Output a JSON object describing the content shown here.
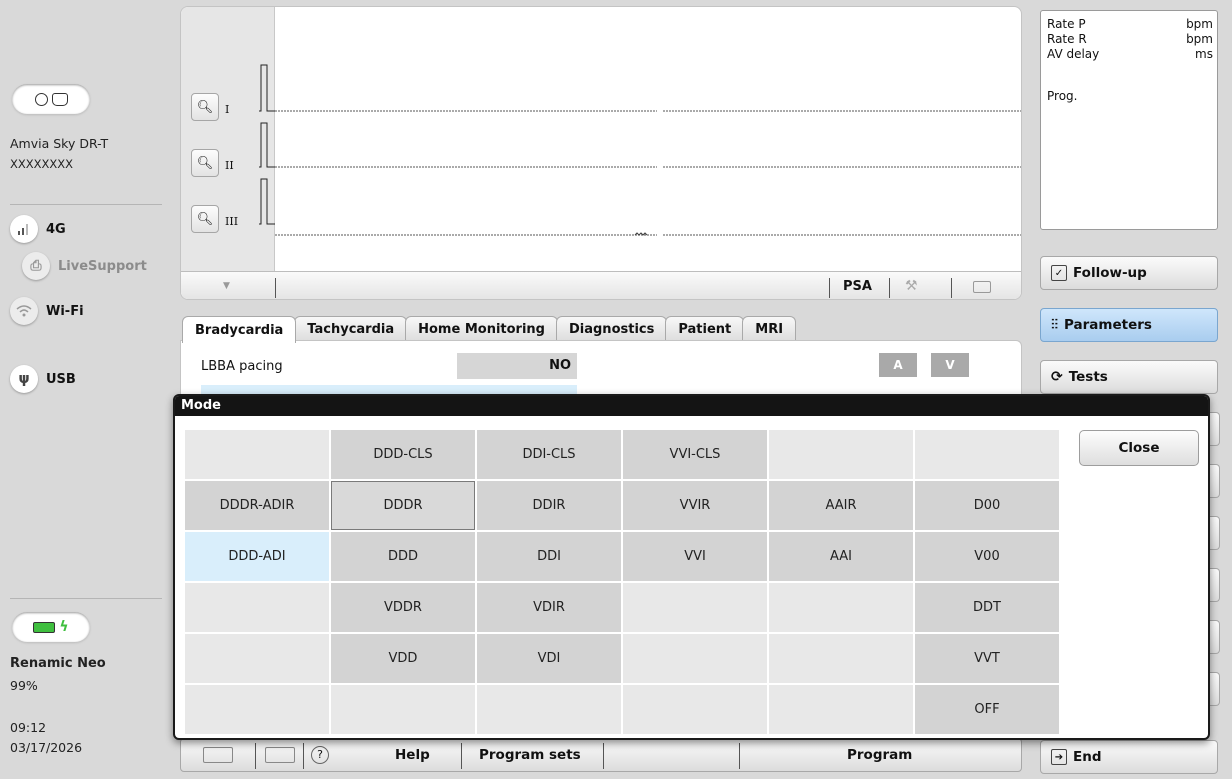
{
  "sidebar": {
    "device_name": "Amvia Sky DR-T",
    "serial": "XXXXXXXX",
    "connections": [
      {
        "label": "4G",
        "icon": "signal-bars-icon",
        "dim": false
      },
      {
        "label": "LiveSupport",
        "icon": "livesupport-icon",
        "dim": true
      },
      {
        "label": "Wi-Fi",
        "icon": "wifi-icon",
        "dim": false
      },
      {
        "label": "USB",
        "icon": "usb-icon",
        "dim": false
      }
    ],
    "programmer_name": "Renamic Neo",
    "battery": "99%",
    "time": "09:12",
    "date": "03/17/2026"
  },
  "ecg": {
    "leads": [
      "I",
      "II",
      "III"
    ],
    "toolbar": {
      "psa": "PSA"
    }
  },
  "info": {
    "rows": [
      {
        "label": "Rate P",
        "unit": "bpm"
      },
      {
        "label": "Rate R",
        "unit": "bpm"
      },
      {
        "label": "AV delay",
        "unit": "ms"
      }
    ],
    "prog": "Prog."
  },
  "nav": {
    "follow_up": "Follow-up",
    "parameters": "Parameters",
    "tests": "Tests",
    "end": "End"
  },
  "tabs": [
    "Bradycardia",
    "Tachycardia",
    "Home Monitoring",
    "Diagnostics",
    "Patient",
    "MRI"
  ],
  "params": {
    "lbba_label": "LBBA pacing",
    "lbba_value": "NO",
    "col_a": "A",
    "col_v": "V"
  },
  "bottom": {
    "help": "Help",
    "program_sets": "Program sets",
    "program": "Program"
  },
  "dialog": {
    "title": "Mode",
    "close": "Close",
    "cells": [
      [
        "",
        "DDD-CLS",
        "DDI-CLS",
        "VVI-CLS",
        "",
        ""
      ],
      [
        "DDDR-ADIR",
        "DDDR",
        "DDIR",
        "VVIR",
        "AAIR",
        "D00"
      ],
      [
        "DDD-ADI",
        "DDD",
        "DDI",
        "VVI",
        "AAI",
        "V00"
      ],
      [
        "",
        "VDDR",
        "VDIR",
        "",
        "",
        "DDT"
      ],
      [
        "",
        "VDD",
        "VDI",
        "",
        "",
        "VVT"
      ],
      [
        "",
        "",
        "",
        "",
        "",
        "OFF"
      ]
    ],
    "selected": "DDD-ADI",
    "current": "DDDR"
  },
  "colors": {
    "selection_blue": "#d9eefb",
    "active_nav": "#a9cdef",
    "battery_green": "#3fbf3f"
  }
}
